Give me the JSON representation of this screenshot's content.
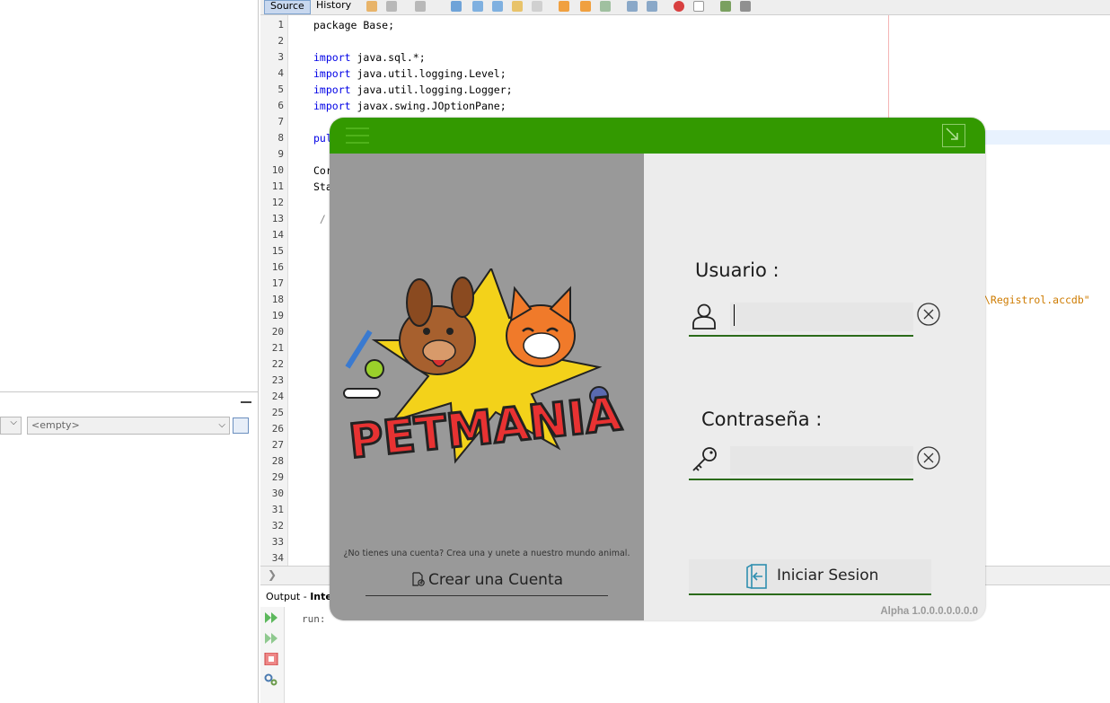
{
  "ide": {
    "tabs": {
      "source": "Source",
      "history": "History"
    },
    "line_numbers": [
      "1",
      "2",
      "3",
      "4",
      "5",
      "6",
      "7",
      "8",
      "9",
      "10",
      "11",
      "12",
      "13",
      "14",
      "15",
      "16",
      "17",
      "18",
      "19",
      "20",
      "21",
      "22",
      "23",
      "24",
      "25",
      "26",
      "27",
      "28",
      "29",
      "30",
      "31",
      "32",
      "33",
      "34"
    ],
    "code": {
      "l1": "package Base;",
      "l3_kw": "import",
      "l3_rest": " java.sql.*;",
      "l4_kw": "import",
      "l4_rest": " java.util.logging.Level;",
      "l5_kw": "import",
      "l5_rest": " java.util.logging.Logger;",
      "l6_kw": "import",
      "l6_rest": " javax.swing.JOptionPane;",
      "l8": "pul",
      "l10": "Cor",
      "l11": "Sta",
      "l13": " /"
    },
    "code_fragment_right": "\\Registrol.accdb\"",
    "left_combo_value": "<empty>",
    "output_tab_label": "Output",
    "output_tab_sep": " - ",
    "output_tab_bold": "Inte",
    "run_text": "run:"
  },
  "dialog": {
    "colors": {
      "titlebar": "#339900",
      "accent": "#2b6b1a",
      "left_pane": "#999999"
    },
    "icons": {
      "menu": "hamburger-icon",
      "minimize": "minimize-icon",
      "user": "user-icon",
      "key": "key-icon",
      "clear": "clear-circle-x-icon",
      "add_document": "add-document-icon",
      "login": "login-door-icon"
    },
    "logo_text": "PETMANIA",
    "invite_text": "¿No tienes una cuenta? Crea una y unete a nuestro mundo animal.",
    "create_account_label": "Crear una Cuenta",
    "user_label": "Usuario :",
    "user_value": "",
    "password_label": "Contraseña :",
    "password_value": "",
    "login_label": "Iniciar Sesion",
    "version": "Alpha 1.0.0.0.0.0.0.0"
  }
}
